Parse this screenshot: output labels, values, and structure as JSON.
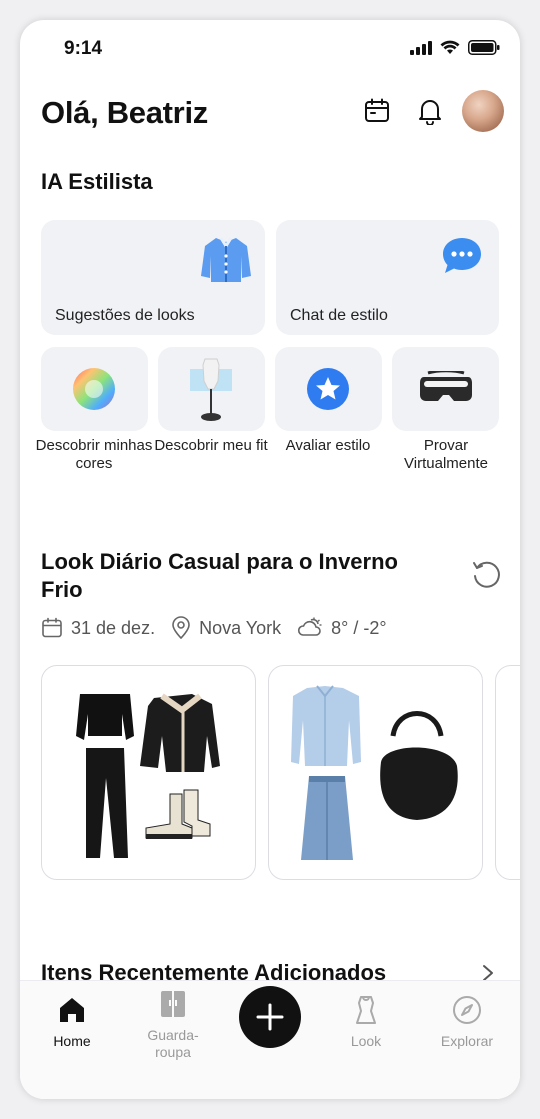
{
  "status_bar": {
    "time": "9:14"
  },
  "header": {
    "greeting": "Olá, Beatriz"
  },
  "stylist": {
    "title": "IA Estilista",
    "large_cards": [
      {
        "label": "Sugestões de looks"
      },
      {
        "label": "Chat de estilo"
      }
    ],
    "small_cards": [
      {
        "label": "Descobrir minhas cores"
      },
      {
        "label": "Descobrir meu fit"
      },
      {
        "label": "Avaliar estilo"
      },
      {
        "label": "Provar Virtualmente"
      }
    ]
  },
  "daily_look": {
    "title": "Look Diário Casual para o Inverno Frio",
    "date": "31 de dez.",
    "location": "Nova York",
    "weather": "8° / -2°"
  },
  "recent": {
    "title": "Itens Recentemente Adicionados"
  },
  "tabbar": {
    "home": "Home",
    "wardrobe": "Guarda-roupa",
    "look": "Look",
    "explore": "Explorar"
  },
  "colors": {
    "card_bg": "#f1f2f6",
    "accent_blue": "#3b82f6",
    "text": "#111111"
  }
}
